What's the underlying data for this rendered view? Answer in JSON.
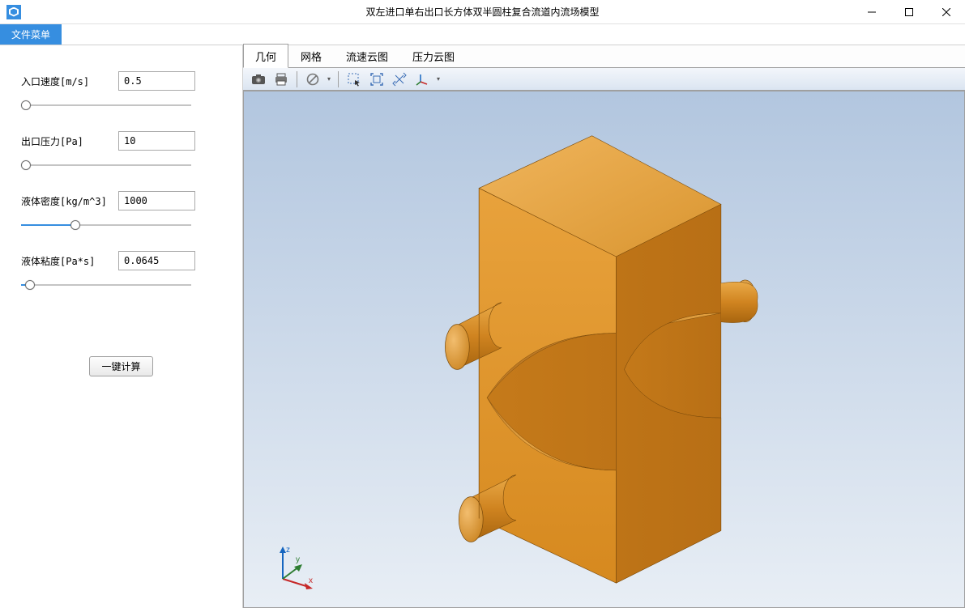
{
  "window": {
    "title": "双左进口单右出口长方体双半圆柱复合流道内流场模型"
  },
  "menu": {
    "file": "文件菜单"
  },
  "params": {
    "inlet_velocity": {
      "label": "入口速度[m/s]",
      "value": "0.5",
      "slider_pct": 3
    },
    "outlet_pressure": {
      "label": "出口压力[Pa]",
      "value": "10",
      "slider_pct": 3
    },
    "density": {
      "label": "液体密度[kg/m^3]",
      "value": "1000",
      "slider_pct": 32
    },
    "viscosity": {
      "label": "液体粘度[Pa*s]",
      "value": "0.0645",
      "slider_pct": 5
    }
  },
  "buttons": {
    "compute": "一键计算"
  },
  "tabs": {
    "items": [
      "几何",
      "网格",
      "流速云图",
      "压力云图"
    ],
    "active": 0
  },
  "toolbar": {
    "icons": [
      "camera",
      "print",
      "no-entry",
      "select-box",
      "zoom-extents",
      "rotate",
      "axis-triad"
    ]
  },
  "triad": {
    "x": "x",
    "y": "y",
    "z": "z"
  },
  "colors": {
    "accent": "#368ee0",
    "solid_light": "#e8a23c",
    "solid_mid": "#d58a1f",
    "solid_dark": "#b8721a"
  }
}
